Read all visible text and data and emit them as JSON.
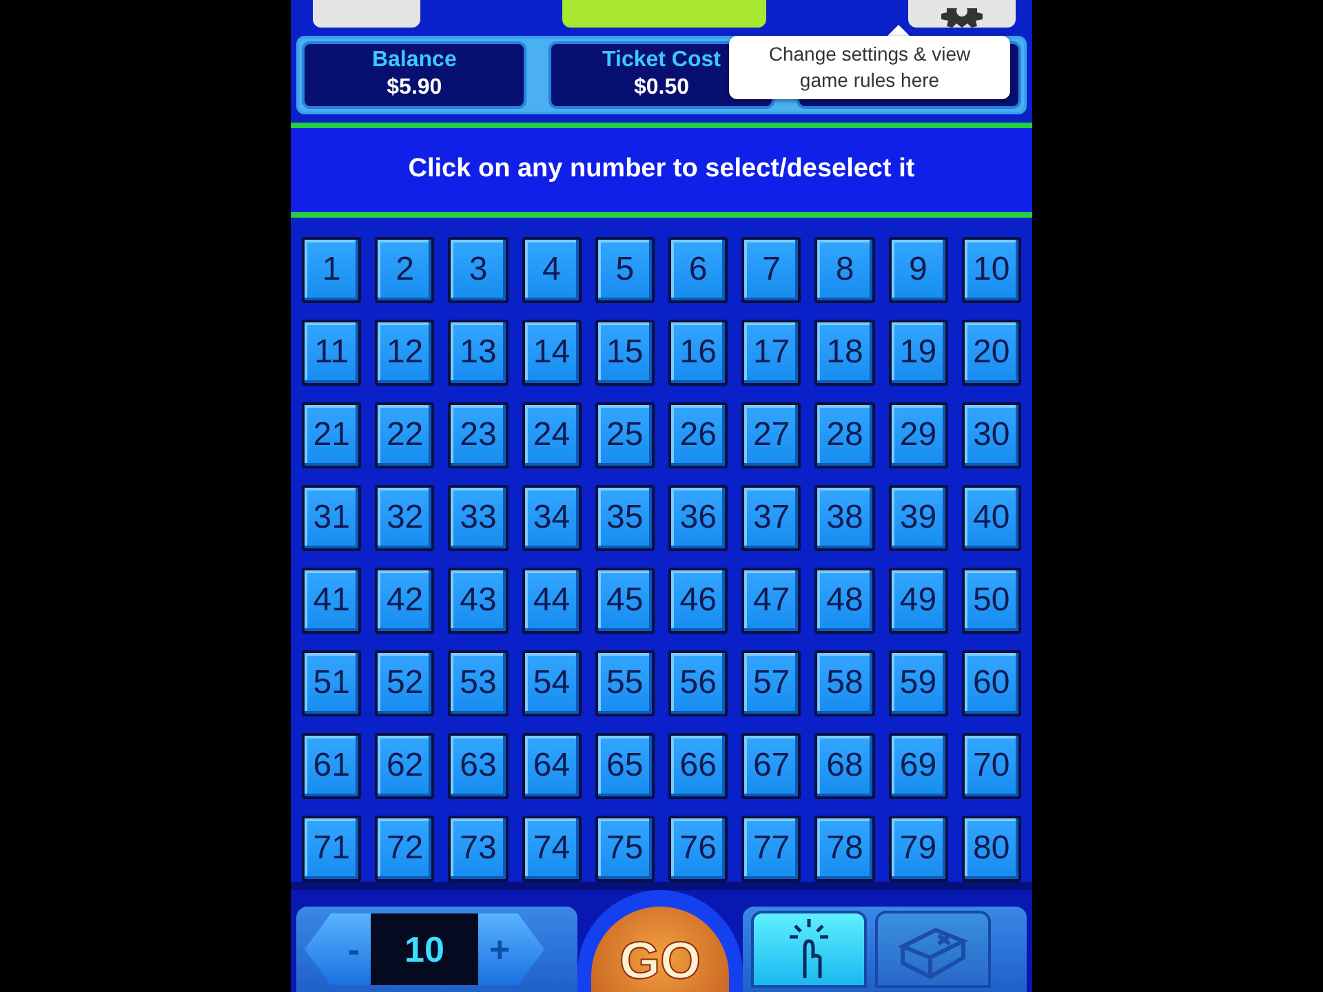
{
  "stats": [
    {
      "label": "Balance",
      "value": "$5.90"
    },
    {
      "label": "Ticket Cost",
      "value": "$0.50"
    }
  ],
  "tooltip": {
    "text": "Change settings & view game rules here"
  },
  "banner": {
    "text": "Click on any number to select/deselect it"
  },
  "numbers": [
    {
      "label": "1",
      "selected": false
    },
    {
      "label": "2",
      "selected": false
    },
    {
      "label": "3",
      "selected": false
    },
    {
      "label": "4",
      "selected": false
    },
    {
      "label": "5",
      "selected": false
    },
    {
      "label": "6",
      "selected": false
    },
    {
      "label": "7",
      "selected": false
    },
    {
      "label": "8",
      "selected": false
    },
    {
      "label": "9",
      "selected": false
    },
    {
      "label": "10",
      "selected": false
    },
    {
      "label": "11",
      "selected": false
    },
    {
      "label": "12",
      "selected": false
    },
    {
      "label": "13",
      "selected": false
    },
    {
      "label": "14",
      "selected": false
    },
    {
      "label": "15",
      "selected": false
    },
    {
      "label": "16",
      "selected": false
    },
    {
      "label": "17",
      "selected": false
    },
    {
      "label": "18",
      "selected": false
    },
    {
      "label": "19",
      "selected": false
    },
    {
      "label": "20",
      "selected": false
    },
    {
      "label": "21",
      "selected": false
    },
    {
      "label": "22",
      "selected": false
    },
    {
      "label": "23",
      "selected": false
    },
    {
      "label": "24",
      "selected": false
    },
    {
      "label": "25",
      "selected": false
    },
    {
      "label": "26",
      "selected": false
    },
    {
      "label": "27",
      "selected": false
    },
    {
      "label": "28",
      "selected": false
    },
    {
      "label": "29",
      "selected": false
    },
    {
      "label": "30",
      "selected": false
    },
    {
      "label": "31",
      "selected": false
    },
    {
      "label": "32",
      "selected": false
    },
    {
      "label": "33",
      "selected": false
    },
    {
      "label": "34",
      "selected": false
    },
    {
      "label": "35",
      "selected": false
    },
    {
      "label": "36",
      "selected": false
    },
    {
      "label": "37",
      "selected": false
    },
    {
      "label": "38",
      "selected": false
    },
    {
      "label": "39",
      "selected": false
    },
    {
      "label": "40",
      "selected": false
    },
    {
      "label": "41",
      "selected": false
    },
    {
      "label": "42",
      "selected": false
    },
    {
      "label": "43",
      "selected": false
    },
    {
      "label": "44",
      "selected": false
    },
    {
      "label": "45",
      "selected": false
    },
    {
      "label": "46",
      "selected": false
    },
    {
      "label": "47",
      "selected": false
    },
    {
      "label": "48",
      "selected": false
    },
    {
      "label": "49",
      "selected": false
    },
    {
      "label": "50",
      "selected": false
    },
    {
      "label": "51",
      "selected": false
    },
    {
      "label": "52",
      "selected": false
    },
    {
      "label": "53",
      "selected": false
    },
    {
      "label": "54",
      "selected": false
    },
    {
      "label": "55",
      "selected": false
    },
    {
      "label": "56",
      "selected": false
    },
    {
      "label": "57",
      "selected": false
    },
    {
      "label": "58",
      "selected": false
    },
    {
      "label": "59",
      "selected": false
    },
    {
      "label": "60",
      "selected": false
    },
    {
      "label": "61",
      "selected": false
    },
    {
      "label": "62",
      "selected": false
    },
    {
      "label": "63",
      "selected": false
    },
    {
      "label": "64",
      "selected": false
    },
    {
      "label": "65",
      "selected": false
    },
    {
      "label": "66",
      "selected": false
    },
    {
      "label": "67",
      "selected": false
    },
    {
      "label": "68",
      "selected": false
    },
    {
      "label": "69",
      "selected": false
    },
    {
      "label": "70",
      "selected": false
    },
    {
      "label": "71",
      "selected": false
    },
    {
      "label": "72",
      "selected": false
    },
    {
      "label": "73",
      "selected": false
    },
    {
      "label": "74",
      "selected": false
    },
    {
      "label": "75",
      "selected": false
    },
    {
      "label": "76",
      "selected": false
    },
    {
      "label": "77",
      "selected": false
    },
    {
      "label": "78",
      "selected": false
    },
    {
      "label": "79",
      "selected": false
    },
    {
      "label": "80",
      "selected": false
    }
  ],
  "stepper": {
    "minus": "-",
    "value": "10",
    "plus": "+"
  },
  "go_button": {
    "label": "GO"
  },
  "modes": [
    {
      "kind": "pick",
      "selected": true
    },
    {
      "kind": "clear",
      "selected": false
    }
  ]
}
